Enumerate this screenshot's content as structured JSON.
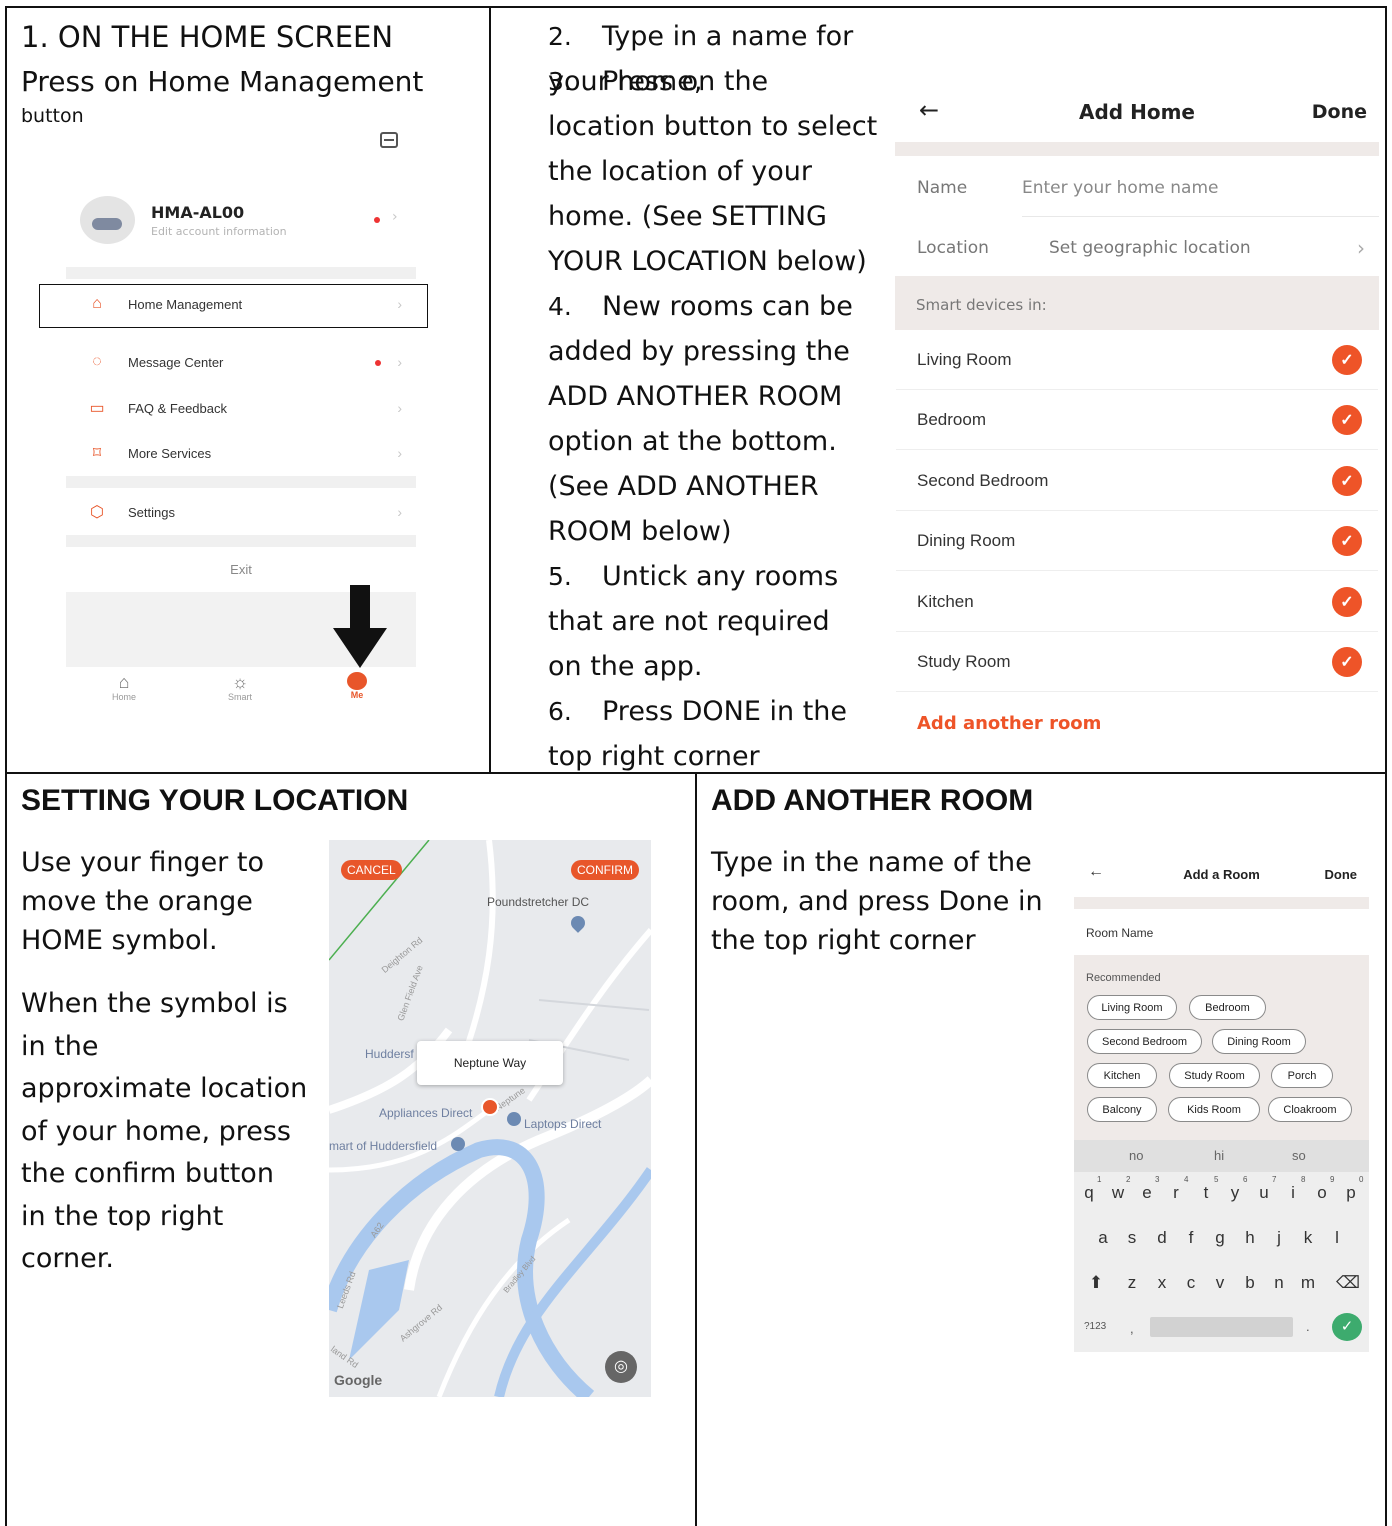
{
  "step1": {
    "heading": "1. ON THE HOME SCREEN",
    "line2": "Press on Home Management",
    "line3": "button",
    "account_name": "HMA-AL00",
    "account_sub": "Edit account information",
    "menu": [
      {
        "label": "Home Management",
        "icon": "home-outline-icon"
      },
      {
        "label": "Message Center",
        "icon": "chat-bubble-icon"
      },
      {
        "label": "FAQ & Feedback",
        "icon": "book-icon"
      },
      {
        "label": "More Services",
        "icon": "bookmark-icon"
      },
      {
        "label": "Settings",
        "icon": "settings-hexagon-icon"
      }
    ],
    "exit": "Exit",
    "nav": [
      "Home",
      "Smart",
      "Me"
    ],
    "accent": "#e8562a"
  },
  "steps": [
    {
      "num": "2.",
      "text": "Type in a name for your home,"
    },
    {
      "num": "3.",
      "text": "Press on the"
    },
    {
      "num": "",
      "text": "location button to select"
    },
    {
      "num": "",
      "text": "the location of your"
    },
    {
      "num": "",
      "text": "home. (See SETTING"
    },
    {
      "num": "",
      "text": "YOUR LOCATION below)"
    },
    {
      "num": "4.",
      "text": "New rooms can be"
    },
    {
      "num": "",
      "text": "added by pressing the"
    },
    {
      "num": "",
      "text": "ADD ANOTHER ROOM"
    },
    {
      "num": "",
      "text": "option at the bottom."
    },
    {
      "num": "",
      "text": "(See ADD ANOTHER"
    },
    {
      "num": "",
      "text": "ROOM below)"
    },
    {
      "num": "5.",
      "text": "Untick any rooms"
    },
    {
      "num": "",
      "text": "that are not required"
    },
    {
      "num": "",
      "text": "on the app."
    },
    {
      "num": "6.",
      "text": "Press DONE in the"
    },
    {
      "num": "",
      "text": "top right corner"
    }
  ],
  "add_home": {
    "title": "Add Home",
    "done": "Done",
    "name_label": "Name",
    "name_placeholder": "Enter your home name",
    "location_label": "Location",
    "location_value": "Set geographic location",
    "section": "Smart devices in:",
    "rooms": [
      "Living Room",
      "Bedroom",
      "Second Bedroom",
      "Dining Room",
      "Kitchen",
      "Study Room"
    ],
    "add_room": "Add another room"
  },
  "location": {
    "heading": "SETTING YOUR LOCATION",
    "para1": [
      "Use your finger to",
      "move the orange",
      "HOME symbol."
    ],
    "para2": [
      "When the symbol is",
      "in the",
      "approximate location",
      "of your home, press",
      "the confirm button",
      "in the top right",
      "corner."
    ],
    "map": {
      "cancel": "CANCEL",
      "confirm": "CONFIRM",
      "popup": "Neptune Way",
      "labels": [
        "Poundstretcher DC",
        "Deighton Rd",
        "Glen Field Ave",
        "Huddersf",
        "Appliances Direct",
        "Laptops Direct",
        "mart of Huddersfield",
        "A62",
        "Leeds Rd",
        "Ashgrove Rd",
        "land Rd",
        "Bradley Blvd",
        "Neptune"
      ],
      "google": "Google"
    }
  },
  "add_room": {
    "heading": "ADD ANOTHER ROOM",
    "para": [
      "Type in the name of the",
      "room, and press Done in",
      "the top right corner"
    ],
    "screen": {
      "title": "Add a Room",
      "done": "Done",
      "field": "Room Name",
      "recommended": "Recommended",
      "chips": [
        "Living Room",
        "Bedroom",
        "Second Bedroom",
        "Dining Room",
        "Kitchen",
        "Study Room",
        "Porch",
        "Balcony",
        "Kids Room",
        "Cloakroom"
      ],
      "suggestions": [
        "no",
        "hi",
        "so"
      ],
      "row1": [
        "q",
        "w",
        "e",
        "r",
        "t",
        "y",
        "u",
        "i",
        "o",
        "p"
      ],
      "row1_nums": [
        "1",
        "2",
        "3",
        "4",
        "5",
        "6",
        "7",
        "8",
        "9",
        "0"
      ],
      "row2": [
        "a",
        "s",
        "d",
        "f",
        "g",
        "h",
        "j",
        "k",
        "l"
      ],
      "row3": [
        "z",
        "x",
        "c",
        "v",
        "b",
        "n",
        "m"
      ],
      "sym": "?123",
      "comma": ",",
      "period": "."
    }
  }
}
